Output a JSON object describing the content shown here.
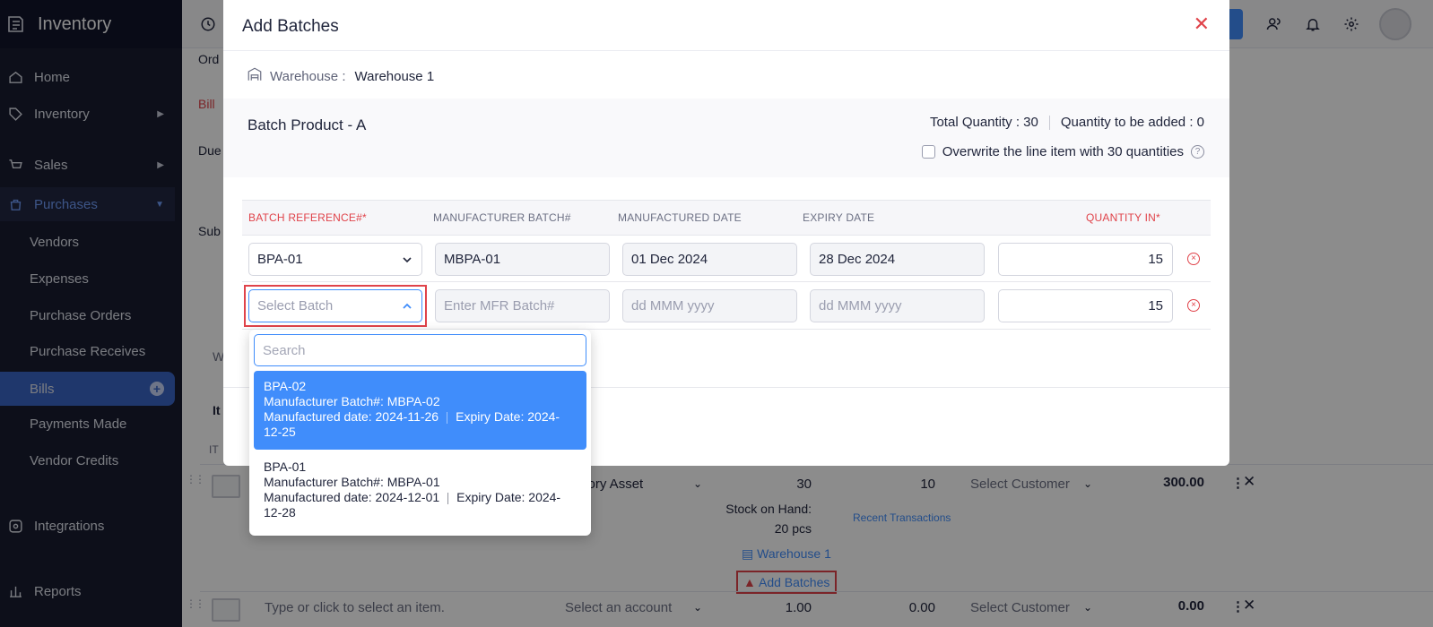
{
  "sidebar": {
    "brand": "Inventory",
    "items": [
      {
        "label": "Home"
      },
      {
        "label": "Inventory"
      },
      {
        "label": "Sales"
      },
      {
        "label": "Purchases"
      },
      {
        "label": "Integrations"
      },
      {
        "label": "Reports"
      }
    ],
    "purchases_sub": [
      {
        "label": "Vendors"
      },
      {
        "label": "Expenses"
      },
      {
        "label": "Purchase Orders"
      },
      {
        "label": "Purchase Receives"
      },
      {
        "label": "Bills"
      },
      {
        "label": "Payments Made"
      },
      {
        "label": "Vendor Credits"
      }
    ],
    "active_color": "#3a64c5"
  },
  "background": {
    "labels": [
      "Ord",
      "Bill",
      "Due",
      "Sub",
      "W",
      "It",
      "IT"
    ],
    "item_row": {
      "account": "ntory Asset",
      "quantity": "30",
      "stock_on_hand_label": "Stock on Hand:",
      "stock_on_hand_value": "20 pcs",
      "warehouse_link": "Warehouse 1",
      "add_batches_link": "Add Batches",
      "rate": "10",
      "recent_transactions": "Recent Transactions",
      "customer": "Select Customer",
      "amount": "300.00"
    },
    "new_row": {
      "item_placeholder": "Type or click to select an item.",
      "account_placeholder": "Select an account",
      "quantity": "1.00",
      "rate": "0.00",
      "customer": "Select Customer",
      "amount": "0.00"
    }
  },
  "modal": {
    "title": "Add Batches",
    "warehouse_label": "Warehouse :",
    "warehouse_value": "Warehouse 1",
    "product_name": "Batch Product - A",
    "total_quantity": "Total Quantity : 30",
    "quantity_to_add": "Quantity to be added : 0",
    "overwrite_label": "Overwrite the line item with 30 quantities",
    "columns": {
      "batch_ref": "BATCH REFERENCE#*",
      "mfr_batch": "MANUFACTURER BATCH#",
      "mfd_date": "MANUFACTURED DATE",
      "expiry": "EXPIRY DATE",
      "quantity": "QUANTITY IN*"
    },
    "rows": [
      {
        "batch": "BPA-01",
        "mfr": "MBPA-01",
        "mfd": "01 Dec 2024",
        "exp": "28 Dec 2024",
        "qty": "15"
      },
      {
        "batch_placeholder": "Select Batch",
        "mfr_placeholder": "Enter MFR Batch#",
        "mfd_placeholder": "dd MMM yyyy",
        "exp_placeholder": "dd MMM yyyy",
        "qty": "15"
      }
    ]
  },
  "dropdown": {
    "search_placeholder": "Search",
    "options": [
      {
        "name": "BPA-02",
        "mfr": "Manufacturer Batch#: MBPA-02",
        "mfd": "Manufactured date: 2024-11-26",
        "exp": "Expiry Date: 2024-12-25"
      },
      {
        "name": "BPA-01",
        "mfr": "Manufacturer Batch#: MBPA-01",
        "mfd": "Manufactured date: 2024-12-01",
        "exp": "Expiry Date: 2024-12-28"
      }
    ]
  },
  "colors": {
    "accent": "#408dfb",
    "danger": "#e0434a",
    "sidebar": "#181c30"
  }
}
